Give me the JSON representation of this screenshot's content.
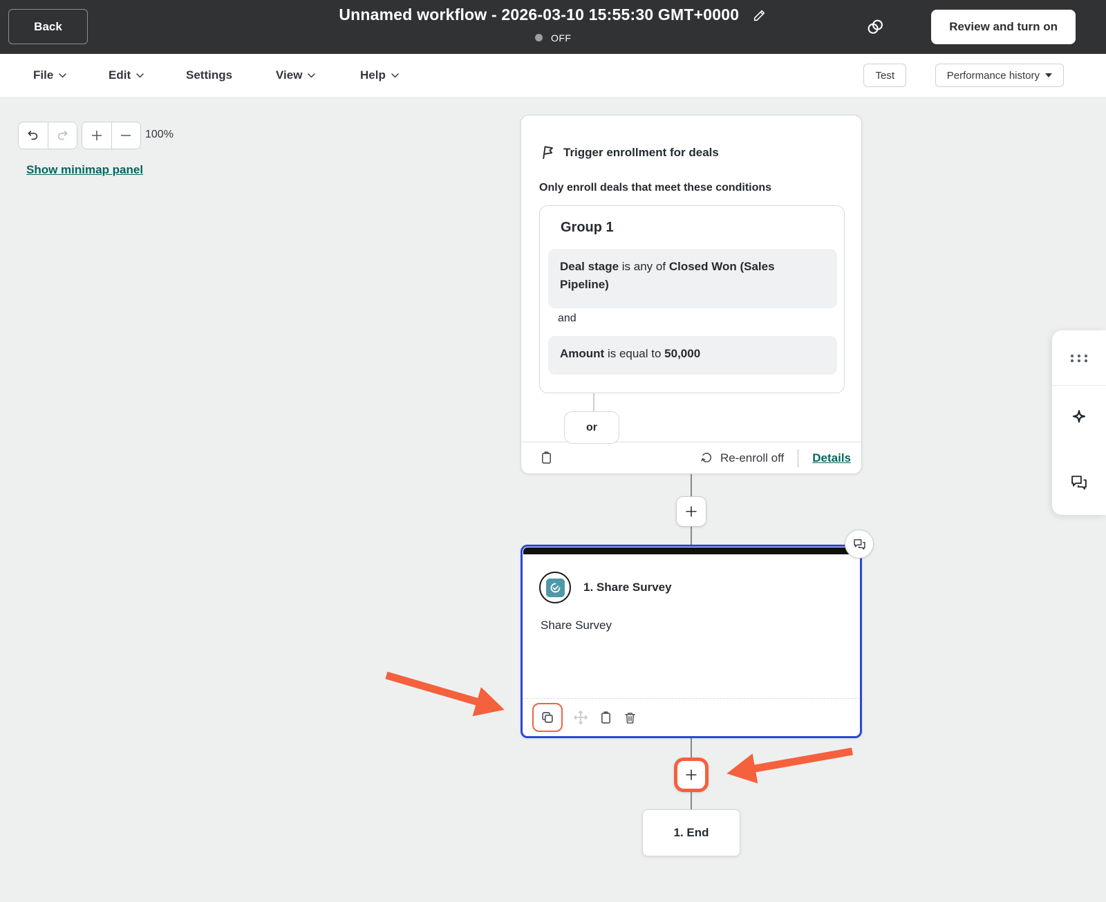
{
  "header": {
    "back_label": "Back",
    "title": "Unnamed workflow - 2026-03-10 15:55:30 GMT+0000",
    "status": "OFF",
    "review_button": "Review and turn on"
  },
  "menubar": {
    "items": [
      {
        "label": "File"
      },
      {
        "label": "Edit"
      },
      {
        "label": "Settings"
      },
      {
        "label": "View"
      },
      {
        "label": "Help"
      }
    ],
    "test_button": "Test",
    "performance_button": "Performance history"
  },
  "canvas_controls": {
    "zoom_level": "100%",
    "minimap_link": "Show minimap panel"
  },
  "trigger_card": {
    "title": "Trigger enrollment for deals",
    "subtitle": "Only enroll deals that meet these conditions",
    "group_title": "Group 1",
    "condition1": {
      "field": "Deal stage",
      "operator": " is any of ",
      "value": "Closed Won (Sales Pipeline)"
    },
    "joiner": "and",
    "condition2": {
      "field": "Amount",
      "operator": " is equal to ",
      "value": "50,000"
    },
    "or_label": "or",
    "reenroll_label": "Re-enroll off",
    "details_label": "Details"
  },
  "action_card": {
    "title": "1. Share Survey",
    "body": "Share Survey"
  },
  "end_card": {
    "label": "1. End"
  },
  "colors": {
    "accent_orange": "#f4613c",
    "selection_blue": "#2b46d3",
    "link_teal": "#0b6361",
    "header_bg": "#313234",
    "canvas_bg": "#eef0f0",
    "action_icon_teal": "#4e99a5"
  }
}
